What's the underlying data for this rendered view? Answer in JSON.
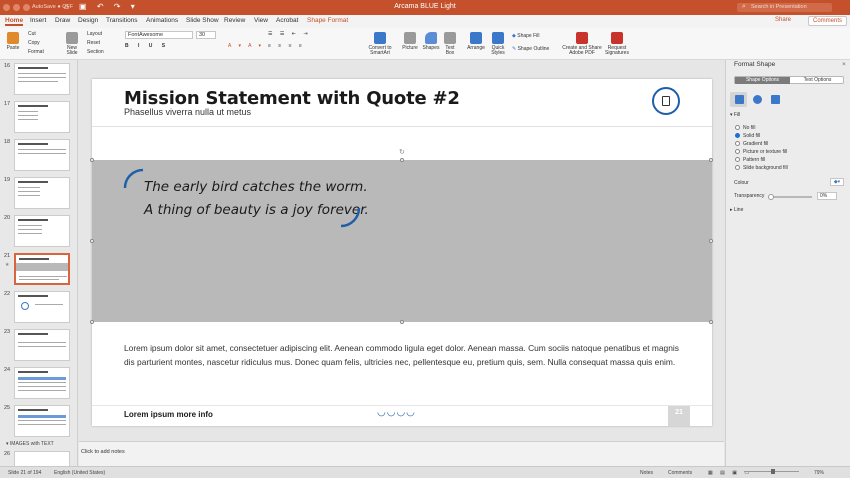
{
  "titlebar": {
    "autosave": "AutoSave ● OFF",
    "doc_title": "Arcama BLUE Light",
    "search_placeholder": "Search in Presentation",
    "qat": "⌂ ▣ ↶ ↷ ▾"
  },
  "tabs": [
    "Home",
    "Insert",
    "Draw",
    "Design",
    "Transitions",
    "Animations",
    "Slide Show",
    "Review",
    "View",
    "Acrobat",
    "Shape Format"
  ],
  "share_label": "Share",
  "comments_label": "Comments",
  "ribbon": {
    "paste": "Paste",
    "cut": "Cut",
    "copy": "Copy",
    "format": "Format",
    "new_slide": "New Slide",
    "layout": "Layout",
    "reset": "Reset",
    "section": "Section",
    "font_name": "FontAwesome",
    "font_size": "30",
    "convert": "Convert to SmartArt",
    "picture": "Picture",
    "shapes": "Shapes",
    "textbox": "Text Box",
    "arrange": "Arrange",
    "quick_styles": "Quick Styles",
    "shape_fill": "Shape Fill",
    "shape_outline": "Shape Outline",
    "create_share": "Create and Share Adobe PDF",
    "request_sig": "Request Signatures"
  },
  "thumbnails": [
    {
      "num": "16"
    },
    {
      "num": "17"
    },
    {
      "num": "18"
    },
    {
      "num": "19"
    },
    {
      "num": "20"
    },
    {
      "num": "21"
    },
    {
      "num": "22"
    },
    {
      "num": "23"
    },
    {
      "num": "24"
    },
    {
      "num": "25"
    }
  ],
  "section_label": "IMAGES with TEXT",
  "last_thumb_num": "26",
  "slide": {
    "title": "Mission Statement with Quote #2",
    "subtitle": "Phasellus viverra nulla ut metus",
    "quote_line1": "The early bird catches the worm.",
    "quote_line2": "A thing of beauty is a joy forever.",
    "body": "Lorem ipsum dolor sit amet, consectetuer adipiscing elit. Aenean commodo ligula eget dolor. Aenean massa. Cum sociis natoque penatibus et magnis dis parturient montes, nascetur ridiculus mus. Donec quam felis, ultricies nec, pellentesque eu, pretium quis, sem. Nulla consequat massa quis enim.",
    "footer": "Lorem ipsum more info",
    "page_number": "21",
    "band_color": "#b9b9b9",
    "accent_color": "#1f5fa8"
  },
  "notes_placeholder": "Click to add notes",
  "panel": {
    "title": "Format Shape",
    "tab_shape": "Shape Options",
    "tab_text": "Text Options",
    "fill_section": "Fill",
    "fill_options": [
      "No fill",
      "Solid fill",
      "Gradient fill",
      "Picture or texture fill",
      "Pattern fill",
      "Slide background fill"
    ],
    "selected_fill": "Solid fill",
    "colour_label": "Colour",
    "transparency_label": "Transparency",
    "transparency_value": "0%",
    "line_section": "Line"
  },
  "status": {
    "slide_info": "Slide 21 of 194",
    "language": "English (United States)",
    "notes": "Notes",
    "comments": "Comments",
    "zoom": "79%"
  }
}
